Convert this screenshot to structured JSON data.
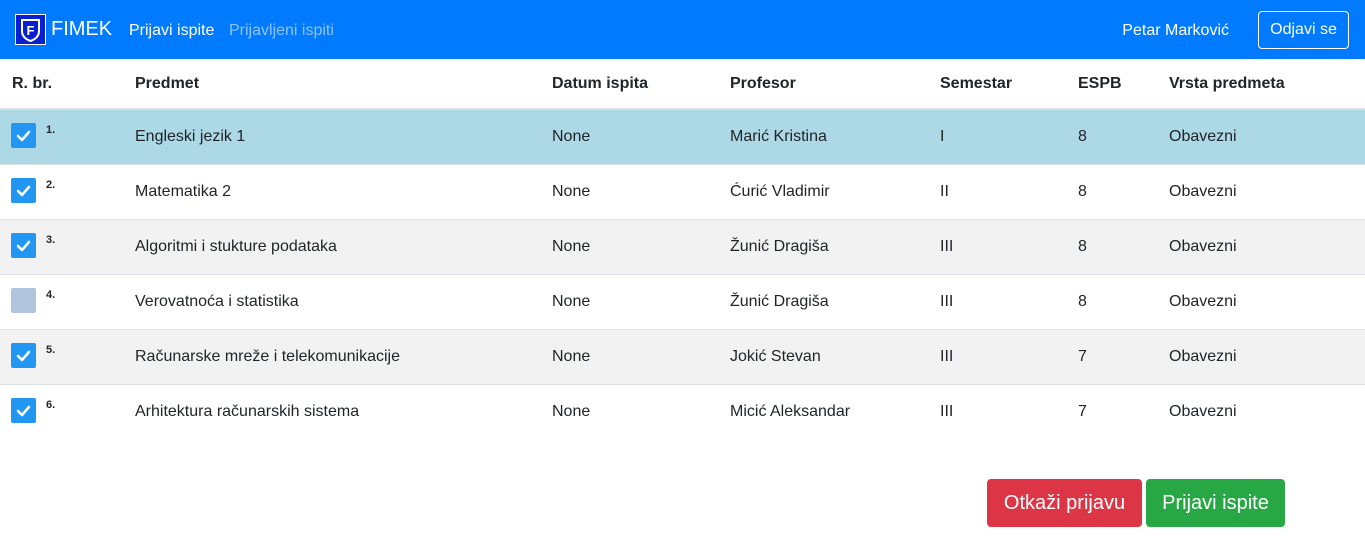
{
  "navbar": {
    "brand": "FIMEK",
    "nav_items": [
      "Prijavi ispite",
      "Prijavljeni ispiti"
    ],
    "user_name": "Petar Marković",
    "logout_label": "Odjavi se",
    "logo_letter": "F",
    "background_color": "#007bff"
  },
  "table": {
    "columns": [
      "R. br.",
      "Predmet",
      "Datum ispita",
      "Profesor",
      "Semestar",
      "ESPB",
      "Vrsta predmeta"
    ],
    "rows": [
      {
        "checked": true,
        "num": "1.",
        "predmet": "Engleski jezik 1",
        "datum": "None",
        "profesor": "Marić Kristina",
        "semestar": "I",
        "espb": "8",
        "vrsta": "Obavezni"
      },
      {
        "checked": true,
        "num": "2.",
        "predmet": "Matematika 2",
        "datum": "None",
        "profesor": "Ćurić Vladimir",
        "semestar": "II",
        "espb": "8",
        "vrsta": "Obavezni"
      },
      {
        "checked": true,
        "num": "3.",
        "predmet": "Algoritmi i stukture podataka",
        "datum": "None",
        "profesor": "Žunić Dragiša",
        "semestar": "III",
        "espb": "8",
        "vrsta": "Obavezni"
      },
      {
        "checked": false,
        "num": "4.",
        "predmet": "Verovatnoća i statistika",
        "datum": "None",
        "profesor": "Žunić Dragiša",
        "semestar": "III",
        "espb": "8",
        "vrsta": "Obavezni"
      },
      {
        "checked": true,
        "num": "5.",
        "predmet": "Računarske mreže i telekomunikacije",
        "datum": "None",
        "profesor": "Jokić Stevan",
        "semestar": "III",
        "espb": "7",
        "vrsta": "Obavezni"
      },
      {
        "checked": true,
        "num": "6.",
        "predmet": "Arhitektura računarskih sistema",
        "datum": "None",
        "profesor": "Micić Aleksandar",
        "semestar": "III",
        "espb": "7",
        "vrsta": "Obavezni"
      }
    ]
  },
  "actions": {
    "cancel_label": "Otkaži prijavu",
    "submit_label": "Prijavi ispite"
  },
  "colors": {
    "checkbox_checked": "#2196f3",
    "checkbox_unchecked": "#b0c4de",
    "selected_row": "#add8e6",
    "cancel_button": "#dc3545",
    "submit_button": "#28a745"
  }
}
